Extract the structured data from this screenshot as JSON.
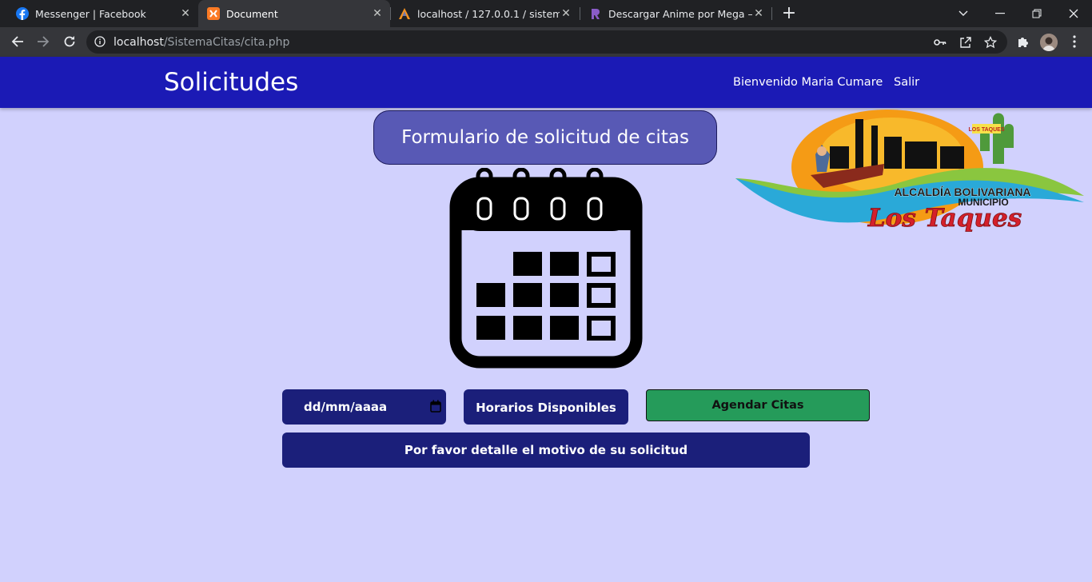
{
  "browser": {
    "tabs": [
      {
        "title": "Messenger | Facebook",
        "icon": "facebook-icon"
      },
      {
        "title": "Document",
        "icon": "xampp-icon"
      },
      {
        "title": "localhost / 127.0.0.1 / sistema_cit",
        "icon": "phpmyadmin-icon"
      },
      {
        "title": "Descargar Anime por Mega – RR",
        "icon": "rr-icon"
      }
    ],
    "url": {
      "host": "localhost",
      "path": "/SistemaCitas/cita.php"
    }
  },
  "navbar": {
    "brand": "Solicitudes",
    "welcome": "Bienvenido Maria Cumare",
    "logout": "Salir"
  },
  "main": {
    "form_title": "Formulario de solicitud de citas",
    "date_placeholder": "dd/mm/aaaa",
    "horarios_label": "Horarios Disponibles",
    "agendar_label": "Agendar Citas",
    "motivo_label": "Por favor detalle el motivo de su solicitud"
  },
  "logo": {
    "line1": "ALCALDÍA BOLIVARIANA",
    "line2": "MUNICIPIO",
    "line3": "Los Taques",
    "sign": "LOS TAQUES"
  },
  "colors": {
    "page_background": "#d1d1fd",
    "navbar": "#1b1ab5",
    "form_title_bg": "#5859b5",
    "button_dark": "#1b1f7a",
    "button_green": "#259b5a"
  }
}
